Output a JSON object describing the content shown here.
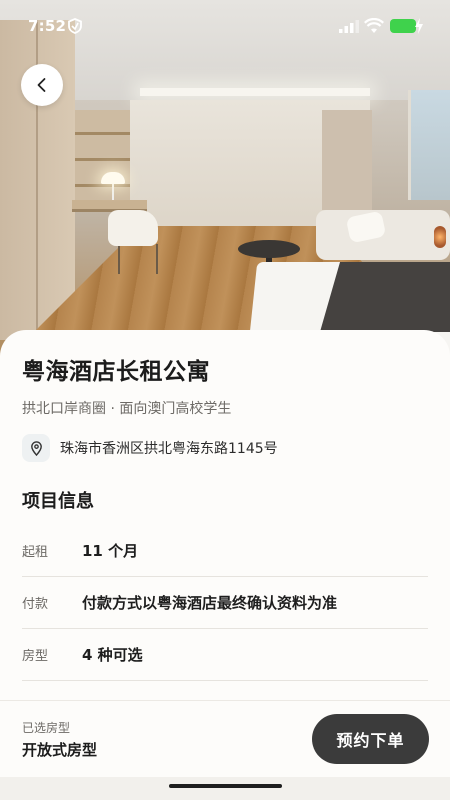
{
  "status_bar": {
    "time": "7:52",
    "icons": [
      "shield-icon",
      "signal-icon",
      "wifi-icon",
      "battery-charging-icon"
    ],
    "battery_color": "#3fd24c"
  },
  "back_icon": "chevron-left-icon",
  "hotel": {
    "name": "粤海酒店长租公寓",
    "subtitle": "拱北口岸商圈 · 面向澳门高校学生",
    "address_icon": "location-pin-icon",
    "address": "珠海市香洲区拱北粤海东路1145号"
  },
  "project_info": {
    "title": "项目信息",
    "rows": [
      {
        "label": "起租",
        "value": "11 个月"
      },
      {
        "label": "付款",
        "value": "付款方式以粤海酒店最终确认资料为准"
      },
      {
        "label": "房型",
        "value": "4 种可选"
      }
    ]
  },
  "bottom_bar": {
    "selected_label": "已选房型",
    "selected_value": "开放式房型",
    "book_button": "预约下单",
    "button_color": "#3b3b3b"
  }
}
